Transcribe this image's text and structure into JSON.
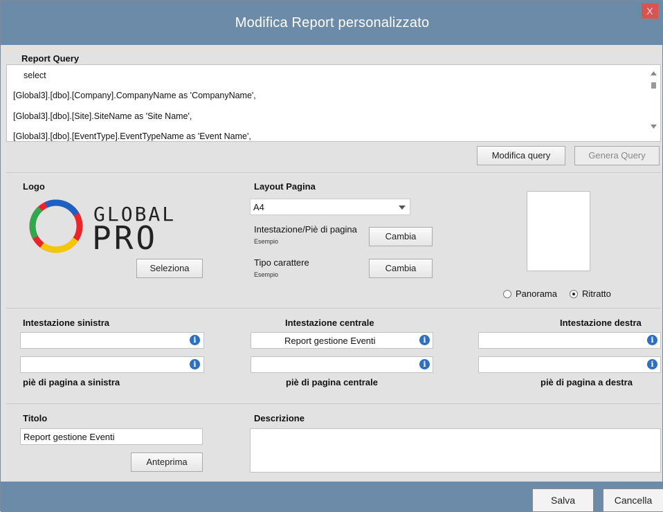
{
  "window": {
    "title": "Modifica Report personalizzato",
    "close_label": "X"
  },
  "query": {
    "label": "Report Query",
    "lines": [
      "select",
      "[Global3].[dbo].[Company].CompanyName as 'CompanyName',",
      "[Global3].[dbo].[Site].SiteName as 'Site Name',",
      "[Global3].[dbo].[EventType].EventTypeName as 'Event Name',"
    ],
    "modify_button": "Modifica query",
    "generate_button": "Genera Query"
  },
  "logo": {
    "label": "Logo",
    "brand_top": "GLOBAL",
    "brand_bottom": "PRO",
    "select_button": "Seleziona"
  },
  "layout": {
    "label": "Layout Pagina",
    "page_size": "A4",
    "header_footer_label": "Intestazione/Piè di pagina",
    "header_footer_example": "Esempio",
    "header_footer_button": "Cambia",
    "font_label": "Tipo carattere",
    "font_example": "Esempio",
    "font_button": "Cambia",
    "orientation_landscape": "Panorama",
    "orientation_portrait": "Ritratto",
    "orientation_selected": "Ritratto"
  },
  "headers": {
    "left_label": "Intestazione sinistra",
    "left_value": "",
    "center_label": "Intestazione centrale",
    "center_value": "Report gestione Eventi",
    "right_label": "Intestazione destra",
    "right_value": ""
  },
  "footers": {
    "left_label": "piè di pagina a sinistra",
    "left_value": "",
    "center_label": "piè di pagina centrale",
    "center_value": "",
    "right_label": "piè di pagina a destra",
    "right_value": ""
  },
  "title": {
    "label": "Titolo",
    "value": "Report gestione Eventi",
    "preview_button": "Anteprima"
  },
  "description": {
    "label": "Descrizione",
    "value": ""
  },
  "footer": {
    "save_button": "Salva",
    "cancel_button": "Cancella"
  },
  "colors": {
    "titlebar": "#6b8ba8",
    "info_icon": "#2f6fc0",
    "close": "#d9534f"
  }
}
